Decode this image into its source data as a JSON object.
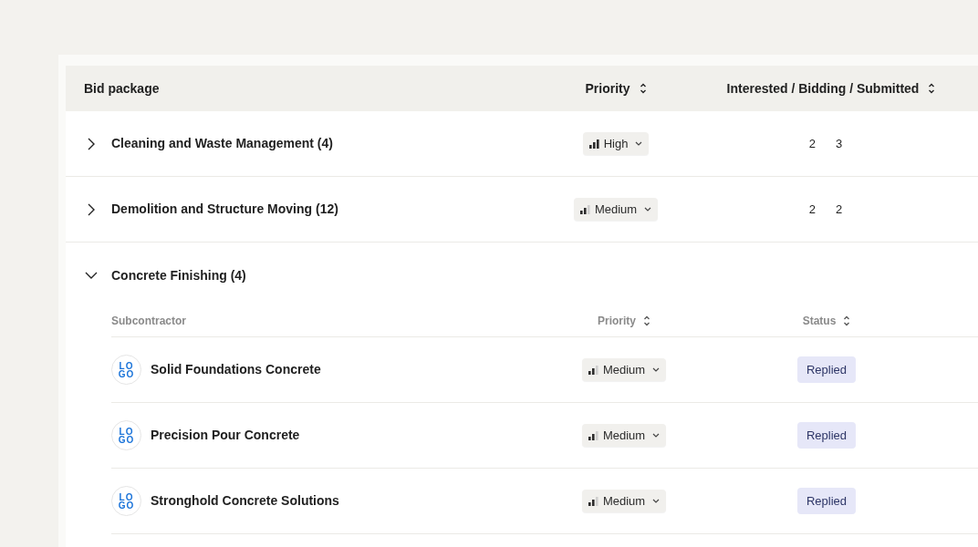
{
  "table": {
    "columns": [
      {
        "label": "Bid package",
        "sortable": false
      },
      {
        "label": "Priority",
        "sortable": true
      },
      {
        "label": "Interested / Bidding / Submitted",
        "sortable": true
      }
    ],
    "groups": [
      {
        "name": "Cleaning and Waste Management (4)",
        "expanded": false,
        "priority": {
          "kind": "high",
          "label": "High"
        },
        "counts": [
          "2",
          "3"
        ]
      },
      {
        "name": "Demolition and Structure Moving (12)",
        "expanded": false,
        "priority": {
          "kind": "medium",
          "label": "Medium"
        },
        "counts": [
          "2",
          "2"
        ]
      },
      {
        "name": "Concrete Finishing (4)",
        "expanded": true,
        "subtable": {
          "columns": [
            {
              "label": "Subcontractor",
              "sortable": false
            },
            {
              "label": "Priority",
              "sortable": true
            },
            {
              "label": "Status",
              "sortable": true
            }
          ],
          "rows": [
            {
              "name": "Solid Foundations Concrete",
              "logo": "LOGO",
              "priority": {
                "kind": "medium",
                "label": "Medium"
              },
              "status": "Replied"
            },
            {
              "name": "Precision Pour Concrete",
              "logo": "LOGO",
              "priority": {
                "kind": "medium",
                "label": "Medium"
              },
              "status": "Replied"
            },
            {
              "name": "Stronghold Concrete Solutions",
              "logo": "LOGO",
              "priority": {
                "kind": "medium",
                "label": "Medium"
              },
              "status": "Replied"
            }
          ]
        }
      }
    ]
  }
}
